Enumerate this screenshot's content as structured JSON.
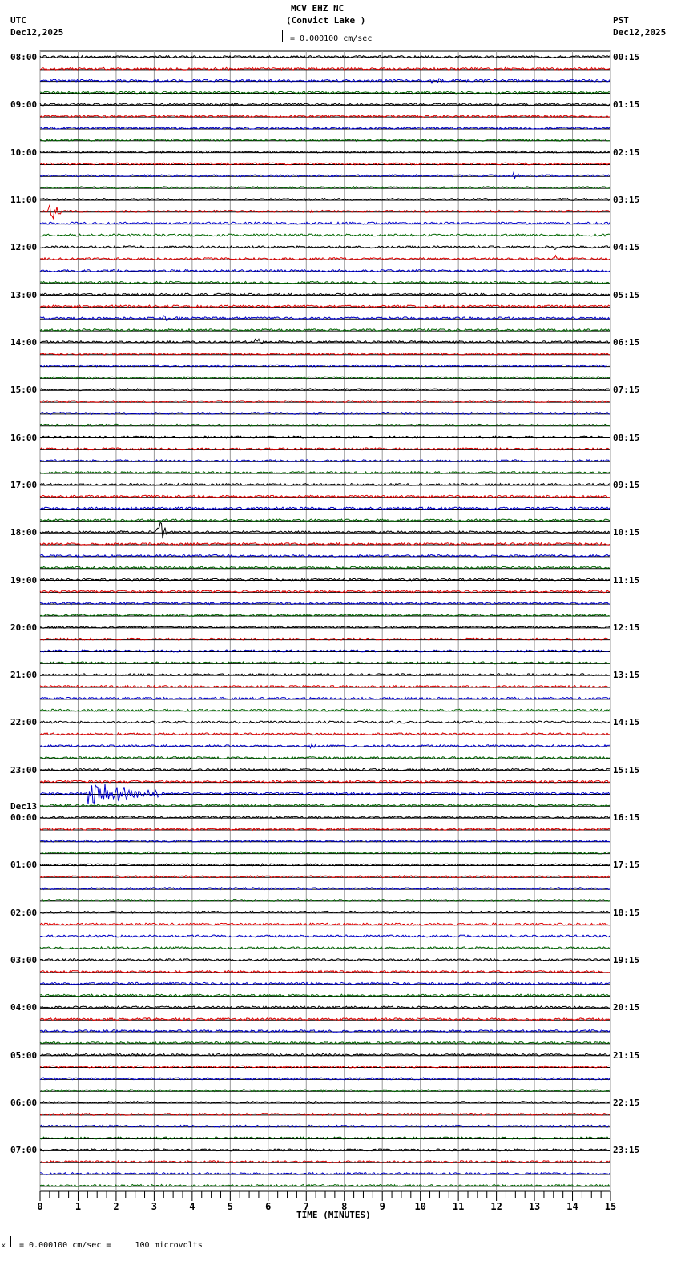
{
  "header": {
    "station": "MCV EHZ NC",
    "location": "(Convict Lake )",
    "left_tz": "UTC",
    "left_date": "Dec12,2025",
    "right_tz": "PST",
    "right_date": "Dec12,2025",
    "scale": "= 0.000100 cm/sec"
  },
  "footer": {
    "scale": "= 0.000100 cm/sec =     100 microvolts",
    "marker": "x"
  },
  "chart_data": {
    "type": "line",
    "title": "MCV EHZ NC (Convict Lake )",
    "xlabel": "TIME (MINUTES)",
    "xlim": [
      0,
      15
    ],
    "x_ticks": [
      "0",
      "1",
      "2",
      "3",
      "4",
      "5",
      "6",
      "7",
      "8",
      "9",
      "10",
      "11",
      "12",
      "13",
      "14",
      "15"
    ],
    "trace_count": 96,
    "trace_minutes": 15,
    "colors": [
      "#000000",
      "#e00000",
      "#0000cc",
      "#006600"
    ],
    "left_labels": [
      "08:00",
      "09:00",
      "10:00",
      "11:00",
      "12:00",
      "13:00",
      "14:00",
      "15:00",
      "16:00",
      "17:00",
      "18:00",
      "19:00",
      "20:00",
      "21:00",
      "22:00",
      "23:00",
      "00:00",
      "01:00",
      "02:00",
      "03:00",
      "04:00",
      "05:00",
      "06:00",
      "07:00"
    ],
    "left_date_change": {
      "hour_index": 16,
      "label": "Dec13"
    },
    "right_labels": [
      "00:15",
      "01:15",
      "02:15",
      "03:15",
      "04:15",
      "05:15",
      "06:15",
      "07:15",
      "08:15",
      "09:15",
      "10:15",
      "11:15",
      "12:15",
      "13:15",
      "14:15",
      "15:15",
      "16:15",
      "17:15",
      "18:15",
      "19:15",
      "20:15",
      "21:15",
      "22:15",
      "23:15"
    ],
    "events": [
      {
        "trace": 2,
        "minute": 10.3,
        "duration": 0.8,
        "amplitude": 2
      },
      {
        "trace": 10,
        "minute": 12.4,
        "duration": 0.3,
        "amplitude": 4
      },
      {
        "trace": 13,
        "minute": 0.2,
        "duration": 0.4,
        "amplitude": 12
      },
      {
        "trace": 16,
        "minute": 13.5,
        "duration": 0.1,
        "amplitude": 30
      },
      {
        "trace": 17,
        "minute": 13.5,
        "duration": 0.1,
        "amplitude": 30
      },
      {
        "trace": 22,
        "minute": 3.2,
        "duration": 0.6,
        "amplitude": 2
      },
      {
        "trace": 24,
        "minute": 5.65,
        "duration": 0.2,
        "amplitude": 9
      },
      {
        "trace": 40,
        "minute": 3.05,
        "duration": 0.3,
        "amplitude": 20
      },
      {
        "trace": 58,
        "minute": 7.0,
        "duration": 0.3,
        "amplitude": 3
      },
      {
        "trace": 62,
        "minute": 1.25,
        "duration": 1.9,
        "amplitude": 14
      }
    ]
  }
}
